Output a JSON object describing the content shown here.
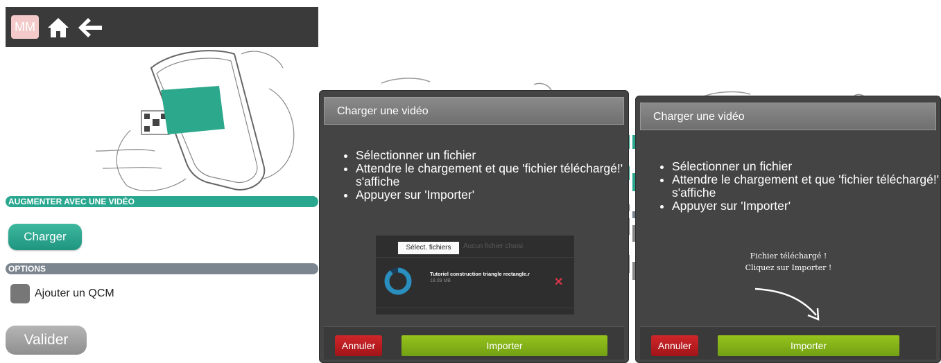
{
  "app": {
    "logo_text": "MM",
    "section_augment": "AUGMENTER AVEC UNE VIDÉO",
    "charger_button": "Charger",
    "section_options": "OPTIONS",
    "qcm_label": "Ajouter un QCM",
    "valider_button": "Valider",
    "colors": {
      "accent": "#2aa78f",
      "options_bar": "#7b8590",
      "topbar": "#3a3a3a"
    }
  },
  "dialog_uploading": {
    "title": "Charger une vidéo",
    "instructions": [
      "Sélectionner un fichier",
      "Attendre le chargement et que 'fichier téléchargé!' s'affiche",
      "Appuyer sur 'Importer'"
    ],
    "file_widget": {
      "select_button": "Sélect. fichiers",
      "no_file_text": "Aucun fichier choisi",
      "file_name": "Tutoriel construction triangle rectangle.r",
      "file_size": "18.09 MB",
      "progress": 0.9
    },
    "cancel_button": "Annuler",
    "import_button": "Importer"
  },
  "dialog_uploaded": {
    "title": "Charger une vidéo",
    "instructions": [
      "Sélectionner un fichier",
      "Attendre le chargement et que 'fichier téléchargé!' s'affiche",
      "Appuyer sur 'Importer'"
    ],
    "message_line1": "Fichier téléchargé !",
    "message_line2": "Cliquez sur Importer !",
    "cancel_button": "Annuler",
    "import_button": "Importer"
  },
  "icons": [
    "logo-icon",
    "home-icon",
    "back-arrow-icon",
    "progress-ring-icon",
    "close-icon",
    "curved-arrow-icon"
  ]
}
